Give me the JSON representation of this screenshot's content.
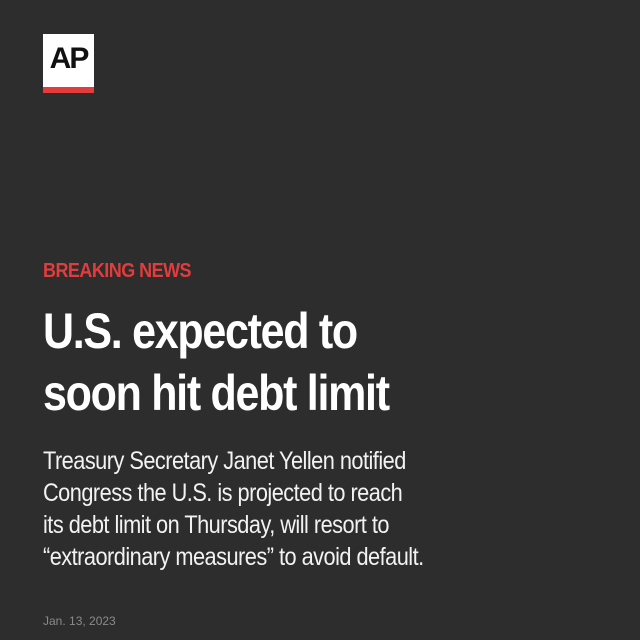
{
  "brand": {
    "logo_text": "AP",
    "accent_color": "#e23c3c"
  },
  "story": {
    "kicker": "BREAKING NEWS",
    "headline_lines": [
      "U.S. expected to",
      "soon hit debt limit"
    ],
    "summary_lines": [
      "Treasury Secretary Janet Yellen notified",
      "Congress the U.S. is projected to reach",
      "its debt limit on Thursday, will resort to",
      "“extraordinary measures” to avoid default."
    ],
    "date": "Jan. 13, 2023"
  }
}
